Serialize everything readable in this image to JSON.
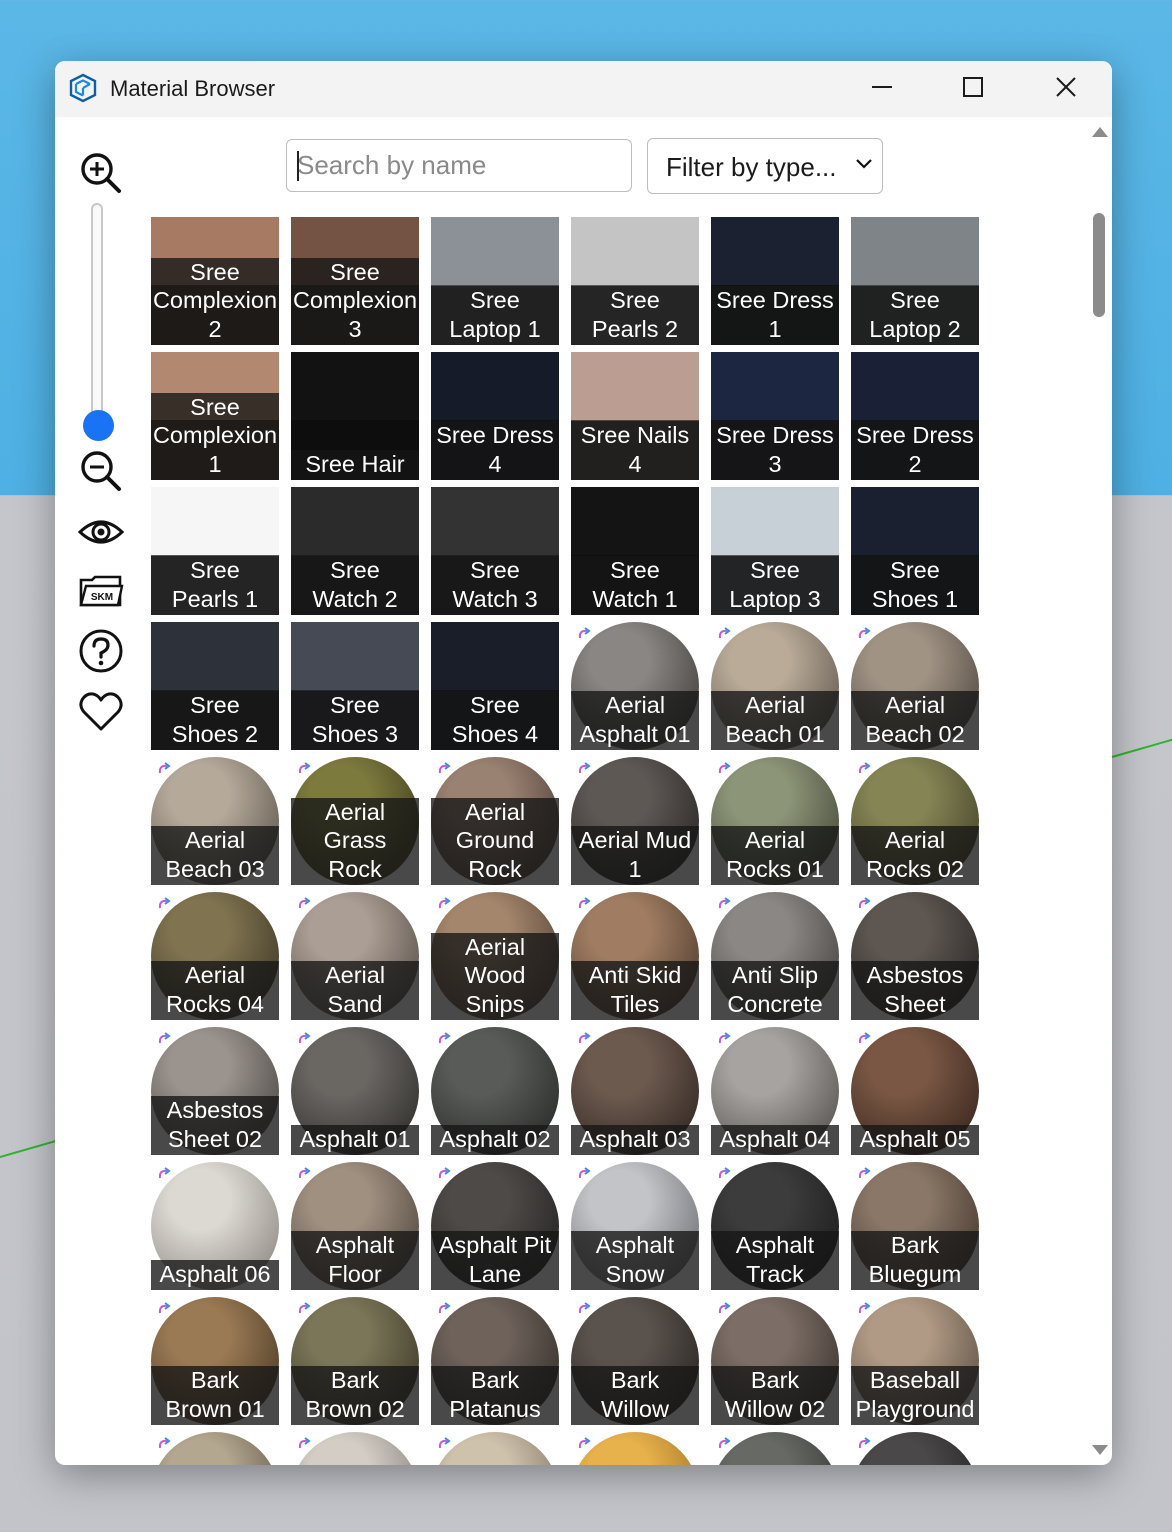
{
  "window": {
    "title": "Material Browser",
    "app_icon": "sketchup-icon",
    "controls": [
      "minimize-icon",
      "maximize-icon",
      "close-icon"
    ]
  },
  "toolbar": {
    "tools": [
      "zoom-in-icon",
      "zoom-slider",
      "zoom-out-icon",
      "eye-icon",
      "skm-icon",
      "help-icon",
      "heart-icon"
    ],
    "skm_label": "SKM",
    "slider_level": 0.1
  },
  "search": {
    "placeholder": "Search by name",
    "value": ""
  },
  "filter": {
    "label": "Filter by type..."
  },
  "materials": [
    {
      "name": "Sree\nComplexion\n2",
      "kind": "flat",
      "c1": "#a67a63",
      "c2": "#3a2a22"
    },
    {
      "name": "Sree\nComplexion\n3",
      "kind": "flat",
      "c1": "#745244",
      "c2": "#2f2520"
    },
    {
      "name": "Sree\nLaptop 1",
      "kind": "flat",
      "c1": "#8b9196",
      "c2": "#4a4c4f"
    },
    {
      "name": "Sree\nPearls 2",
      "kind": "flat",
      "c1": "#c4c4c4",
      "c2": "#5b5b5b"
    },
    {
      "name": "Sree Dress\n1",
      "kind": "flat",
      "c1": "#1c2132",
      "c2": "#111216"
    },
    {
      "name": "Sree\nLaptop 2",
      "kind": "flat",
      "c1": "#7f8488",
      "c2": "#45484b"
    },
    {
      "name": "Sree\nComplexion\n1",
      "kind": "flat",
      "c1": "#b28870",
      "c2": "#3b2d26"
    },
    {
      "name": "Sree Hair",
      "kind": "flat",
      "c1": "#121212",
      "c2": "#0d0d0d"
    },
    {
      "name": "Sree Dress\n4",
      "kind": "flat",
      "c1": "#151b28",
      "c2": "#0f1117"
    },
    {
      "name": "Sree Nails\n4",
      "kind": "flat",
      "c1": "#bb9d92",
      "c2": "#4e4543"
    },
    {
      "name": "Sree Dress\n3",
      "kind": "flat",
      "c1": "#1d2641",
      "c2": "#121521"
    },
    {
      "name": "Sree Dress\n2",
      "kind": "flat",
      "c1": "#1a2036",
      "c2": "#111419"
    },
    {
      "name": "Sree\nPearls 1",
      "kind": "flat",
      "c1": "#f6f6f6",
      "c2": "#585858"
    },
    {
      "name": "Sree\nWatch 2",
      "kind": "flat",
      "c1": "#2b2b2b",
      "c2": "#1c1c1c"
    },
    {
      "name": "Sree\nWatch 3",
      "kind": "flat",
      "c1": "#333333",
      "c2": "#202020"
    },
    {
      "name": "Sree\nWatch 1",
      "kind": "flat",
      "c1": "#141414",
      "c2": "#0e0e0e"
    },
    {
      "name": "Sree\nLaptop 3",
      "kind": "flat",
      "c1": "#c7d0d7",
      "c2": "#55595c"
    },
    {
      "name": "Sree\nShoes 1",
      "kind": "flat",
      "c1": "#1a2030",
      "c2": "#111419"
    },
    {
      "name": "Sree\nShoes 2",
      "kind": "flat",
      "c1": "#2d313a",
      "c2": "#1b1d21"
    },
    {
      "name": "Sree\nShoes 3",
      "kind": "flat",
      "c1": "#464a55",
      "c2": "#26282d"
    },
    {
      "name": "Sree\nShoes 4",
      "kind": "flat",
      "c1": "#1a1e29",
      "c2": "#111318"
    },
    {
      "name": "Aerial\nAsphalt 01",
      "kind": "sphere",
      "c1": "#8a8684",
      "c2": "#2f2c2a"
    },
    {
      "name": "Aerial\nBeach 01",
      "kind": "sphere",
      "c1": "#b9ab98",
      "c2": "#4c453e"
    },
    {
      "name": "Aerial\nBeach 02",
      "kind": "sphere",
      "c1": "#a09384",
      "c2": "#3d3730"
    },
    {
      "name": "Aerial\nBeach 03",
      "kind": "sphere",
      "c1": "#b5a99a",
      "c2": "#4a443c"
    },
    {
      "name": "Aerial\nGrass\nRock",
      "kind": "sphere",
      "c1": "#7d7a3e",
      "c2": "#2f2c18"
    },
    {
      "name": "Aerial\nGround\nRock",
      "kind": "sphere",
      "c1": "#9a8272",
      "c2": "#3b2f28"
    },
    {
      "name": "Aerial Mud\n1",
      "kind": "sphere",
      "c1": "#5e5855",
      "c2": "#1b1a19"
    },
    {
      "name": "Aerial\nRocks 01",
      "kind": "sphere",
      "c1": "#8d9578",
      "c2": "#33372a"
    },
    {
      "name": "Aerial\nRocks 02",
      "kind": "sphere",
      "c1": "#858455",
      "c2": "#36341f"
    },
    {
      "name": "Aerial\nRocks 04",
      "kind": "sphere",
      "c1": "#7f7350",
      "c2": "#302a1c"
    },
    {
      "name": "Aerial\nSand",
      "kind": "sphere",
      "c1": "#ab9e94",
      "c2": "#453d37"
    },
    {
      "name": "Aerial\nWood\nSnips",
      "kind": "sphere",
      "c1": "#a4866c",
      "c2": "#3f3126"
    },
    {
      "name": "Anti Skid\nTiles",
      "kind": "sphere",
      "c1": "#a07d62",
      "c2": "#3d2d22"
    },
    {
      "name": "Anti Slip\nConcrete",
      "kind": "sphere",
      "c1": "#8b8784",
      "c2": "#353331"
    },
    {
      "name": "Asbestos\nSheet",
      "kind": "sphere",
      "c1": "#5d5651",
      "c2": "#1f1c1a"
    },
    {
      "name": "Asbestos\nSheet 02",
      "kind": "sphere",
      "c1": "#9a938e",
      "c2": "#3a3633"
    },
    {
      "name": "Asphalt 01",
      "kind": "sphere",
      "c1": "#6a6763",
      "c2": "#252321"
    },
    {
      "name": "Asphalt 02",
      "kind": "sphere",
      "c1": "#585b58",
      "c2": "#1f2120"
    },
    {
      "name": "Asphalt 03",
      "kind": "sphere",
      "c1": "#6d5a4f",
      "c2": "#261e1a"
    },
    {
      "name": "Asphalt 04",
      "kind": "sphere",
      "c1": "#a6a3a0",
      "c2": "#46433f"
    },
    {
      "name": "Asphalt 05",
      "kind": "sphere",
      "c1": "#7a5744",
      "c2": "#2c1d16"
    },
    {
      "name": "Asphalt 06",
      "kind": "sphere",
      "c1": "#dcd8d2",
      "c2": "#7e7973"
    },
    {
      "name": "Asphalt\nFloor",
      "kind": "sphere",
      "c1": "#a09080",
      "c2": "#3e3630"
    },
    {
      "name": "Asphalt Pit\nLane",
      "kind": "sphere",
      "c1": "#4e4a48",
      "c2": "#1a1918"
    },
    {
      "name": "Asphalt\nSnow",
      "kind": "sphere",
      "c1": "#c3c4c8",
      "c2": "#5a5b60"
    },
    {
      "name": "Asphalt\nTrack",
      "kind": "sphere",
      "c1": "#3d3c3c",
      "c2": "#141414"
    },
    {
      "name": "Bark\nBluegum",
      "kind": "sphere",
      "c1": "#8a7767",
      "c2": "#332920"
    },
    {
      "name": "Bark\nBrown 01",
      "kind": "sphere",
      "c1": "#9a7a55",
      "c2": "#3a2b1b"
    },
    {
      "name": "Bark\nBrown 02",
      "kind": "sphere",
      "c1": "#7b7658",
      "c2": "#2d2a1d"
    },
    {
      "name": "Bark\nPlatanus",
      "kind": "sphere",
      "c1": "#6e625b",
      "c2": "#27221f"
    },
    {
      "name": "Bark\nWillow",
      "kind": "sphere",
      "c1": "#5a524d",
      "c2": "#1e1b19"
    },
    {
      "name": "Bark\nWillow 02",
      "kind": "sphere",
      "c1": "#7c6e66",
      "c2": "#2b2522"
    },
    {
      "name": "Baseball\nPlayground",
      "kind": "sphere",
      "c1": "#b09a85",
      "c2": "#4a3f35"
    },
    {
      "name": "",
      "kind": "sphere",
      "c1": "#b4a790",
      "c2": "#4a4234"
    },
    {
      "name": "",
      "kind": "sphere",
      "c1": "#d3cdc6",
      "c2": "#6d6862"
    },
    {
      "name": "",
      "kind": "sphere",
      "c1": "#cfc2ad",
      "c2": "#6a5f50"
    },
    {
      "name": "",
      "kind": "sphere",
      "c1": "#e7b24c",
      "c2": "#8a5e18"
    },
    {
      "name": "",
      "kind": "sphere",
      "c1": "#676a64",
      "c2": "#272826"
    },
    {
      "name": "",
      "kind": "sphere",
      "c1": "#4a4848",
      "c2": "#191818"
    }
  ],
  "scrollbar": {
    "position": 0.05
  }
}
